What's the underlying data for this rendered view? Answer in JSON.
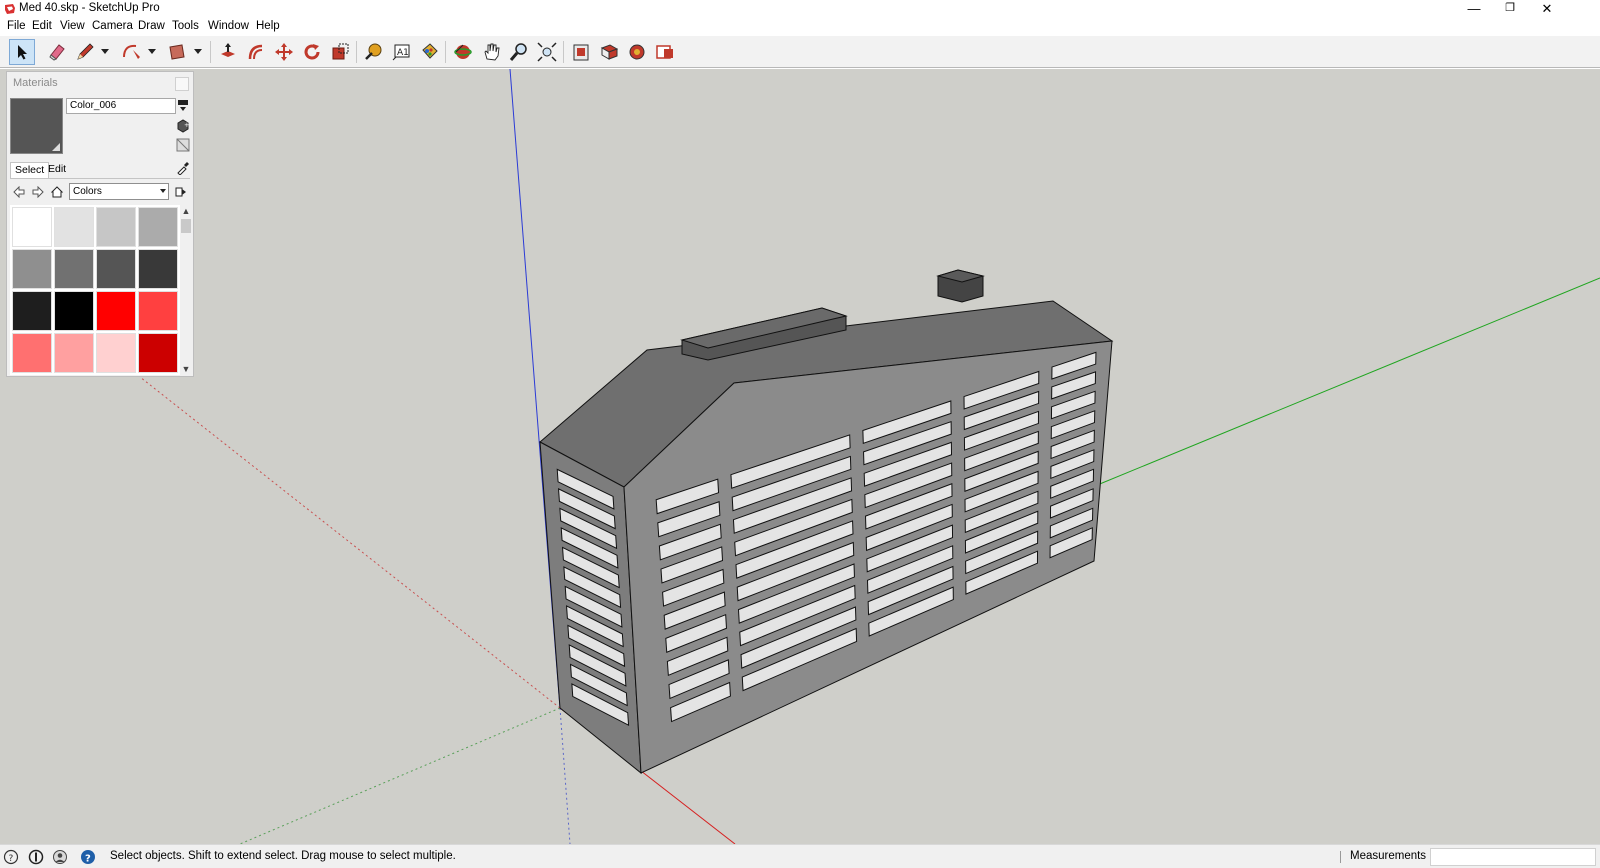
{
  "window": {
    "title": "Med 40.skp - SketchUp Pro",
    "controls": {
      "minimize": "—",
      "restore": "❐",
      "close": "✕"
    }
  },
  "menu": [
    "File",
    "Edit",
    "View",
    "Camera",
    "Draw",
    "Tools",
    "Window",
    "Help"
  ],
  "toolbar": {
    "tools": [
      "select-tool",
      "eraser-tool",
      "line-tool",
      "arc-tool",
      "shapes-tool",
      "push-pull-tool",
      "offset-tool",
      "move-tool",
      "rotate-tool",
      "scale-tool",
      "tape-measure-tool",
      "text-tool",
      "paint-bucket-tool",
      "orbit-tool",
      "pan-tool",
      "zoom-tool",
      "zoom-extents-tool",
      "3d-warehouse",
      "extension-warehouse",
      "extension-manager",
      "layout-send"
    ],
    "active_tool": "select-tool"
  },
  "materials": {
    "title": "Materials",
    "current_name": "Color_006",
    "current_color": "#555555",
    "tabs": [
      "Select",
      "Edit"
    ],
    "active_tab": "Select",
    "collection": "Colors",
    "swatches": [
      "#ffffff",
      "#e2e2e2",
      "#c6c6c6",
      "#ababab",
      "#8f8f8f",
      "#717171",
      "#555555",
      "#393939",
      "#1e1e1e",
      "#000000",
      "#ff0000",
      "#ff4040",
      "#ff7070",
      "#ffa0a0",
      "#ffd0d0",
      "#cc0000"
    ]
  },
  "status": {
    "message": "Select objects. Shift to extend select. Drag mouse to select multiple.",
    "measurements_label": "Measurements",
    "measurements_value": ""
  },
  "colors": {
    "viewport_bg": "#cfcfca",
    "axis_blue": "#2b3bd6",
    "axis_green": "#1fa51f",
    "axis_red": "#d62020",
    "building_front": "#8a8a8a",
    "building_side": "#7a7a7a",
    "building_roof": "#6c6c6c",
    "window_glass": "#e4e4e4"
  }
}
